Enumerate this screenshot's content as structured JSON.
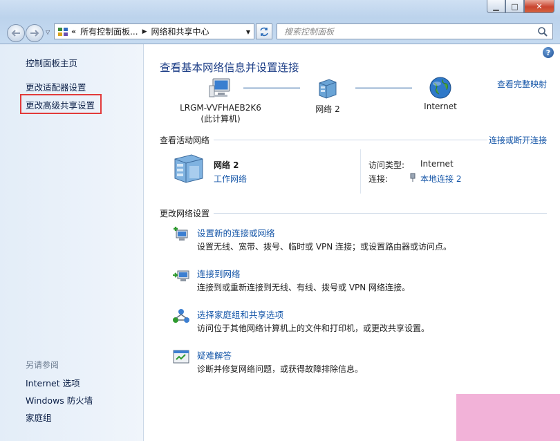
{
  "window": {
    "caption_minimize": "▁",
    "caption_maximize": "□",
    "caption_close": "✕"
  },
  "toolbar": {
    "breadcrumb_chevron": "«",
    "breadcrumb": [
      "所有控制面板...",
      "网络和共享中心"
    ],
    "breadcrumb_separator": "▶",
    "search_placeholder": "搜索控制面板"
  },
  "sidebar": {
    "items": [
      {
        "label": "控制面板主页"
      },
      {
        "label": "更改适配器设置"
      },
      {
        "label": "更改高级共享设置"
      }
    ],
    "see_also_heading": "另请参阅",
    "see_also": [
      {
        "label": "Internet 选项"
      },
      {
        "label": "Windows 防火墙"
      },
      {
        "label": "家庭组"
      }
    ]
  },
  "main": {
    "title": "查看基本网络信息并设置连接",
    "full_map_link": "查看完整映射",
    "map": {
      "computer": {
        "name": "LRGM-VVFHAEB2K6",
        "sub": "(此计算机)"
      },
      "network": {
        "name": "网络  2"
      },
      "internet": {
        "name": "Internet"
      }
    },
    "active_networks": {
      "header": "查看活动网络",
      "link": "连接或断开连接",
      "network_name": "网络  2",
      "network_type": "工作网络",
      "access_type_label": "访问类型:",
      "access_type_value": "Internet",
      "connections_label": "连接:",
      "connections_value": "本地连接 2"
    },
    "change_settings": {
      "header": "更改网络设置",
      "tasks": [
        {
          "title": "设置新的连接或网络",
          "desc": "设置无线、宽带、拨号、临时或 VPN 连接；或设置路由器或访问点。",
          "icon": "new-connection-icon"
        },
        {
          "title": "连接到网络",
          "desc": "连接到或重新连接到无线、有线、拨号或 VPN 网络连接。",
          "icon": "connect-network-icon"
        },
        {
          "title": "选择家庭组和共享选项",
          "desc": "访问位于其他网络计算机上的文件和打印机，或更改共享设置。",
          "icon": "homegroup-icon"
        },
        {
          "title": "疑难解答",
          "desc": "诊断并修复网络问题，或获得故障排除信息。",
          "icon": "troubleshoot-icon"
        }
      ]
    }
  },
  "colors": {
    "link": "#1556a8",
    "title": "#1e3f87",
    "highlight_box": "#e23a3a"
  }
}
